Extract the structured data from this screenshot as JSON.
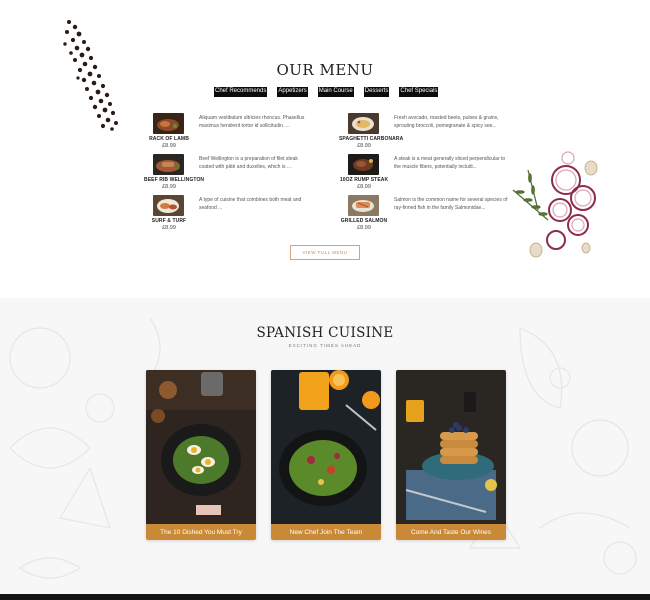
{
  "menu": {
    "title": "OUR MENU",
    "tabs": [
      {
        "label": "Chef Recommends"
      },
      {
        "label": "Appetizers"
      },
      {
        "label": "Main Course"
      },
      {
        "label": "Desserts"
      },
      {
        "label": "Chef Specials"
      }
    ],
    "items": [
      {
        "name": "RACK OF LAMB",
        "price": "£8.99",
        "description": "Aliquam vestibulum ultricies rhoncus. Phasellus maximus hendrerit tortor id sollicitudin. ..."
      },
      {
        "name": "SPAGHETTI CARBONARA",
        "price": "£8.99",
        "description": "Fresh avocado, roasted beets, pulses & grains, sprouting broccoli, pomegranate & spicy see..."
      },
      {
        "name": "BEEF RIB WELLINGTON",
        "price": "£8.99",
        "description": "Beef Wellington is a preparation of filet steak coated with pâté and duxelles, which is ..."
      },
      {
        "name": "10OZ RUMP STEAK",
        "price": "£8.99",
        "description": "A steak is a meat generally sliced perpendicular to the muscle fibers, potentially includi..."
      },
      {
        "name": "SURF & TURF",
        "price": "£8.99",
        "description": "A type of cuisine that combines both meat and seafood ..."
      },
      {
        "name": "GRILLED SALMON",
        "price": "£8.99",
        "description": "Salmon is the common name for several species of ray-finned fish in the family Salmonidae..."
      }
    ],
    "view_button": "VIEW FULL MENU"
  },
  "spanish": {
    "title": "SPANISH CUISINE",
    "subtitle": "EXCITING TIMES AHEAD",
    "cards": [
      {
        "caption": "The 10 Dished You Must Try"
      },
      {
        "caption": "New Chef Join The Team"
      },
      {
        "caption": "Come And Taste Our Wines"
      }
    ]
  },
  "colors": {
    "accent_brown": "#c98937",
    "button_border": "#d8a07a",
    "tab_bg": "#0c0c0c"
  }
}
